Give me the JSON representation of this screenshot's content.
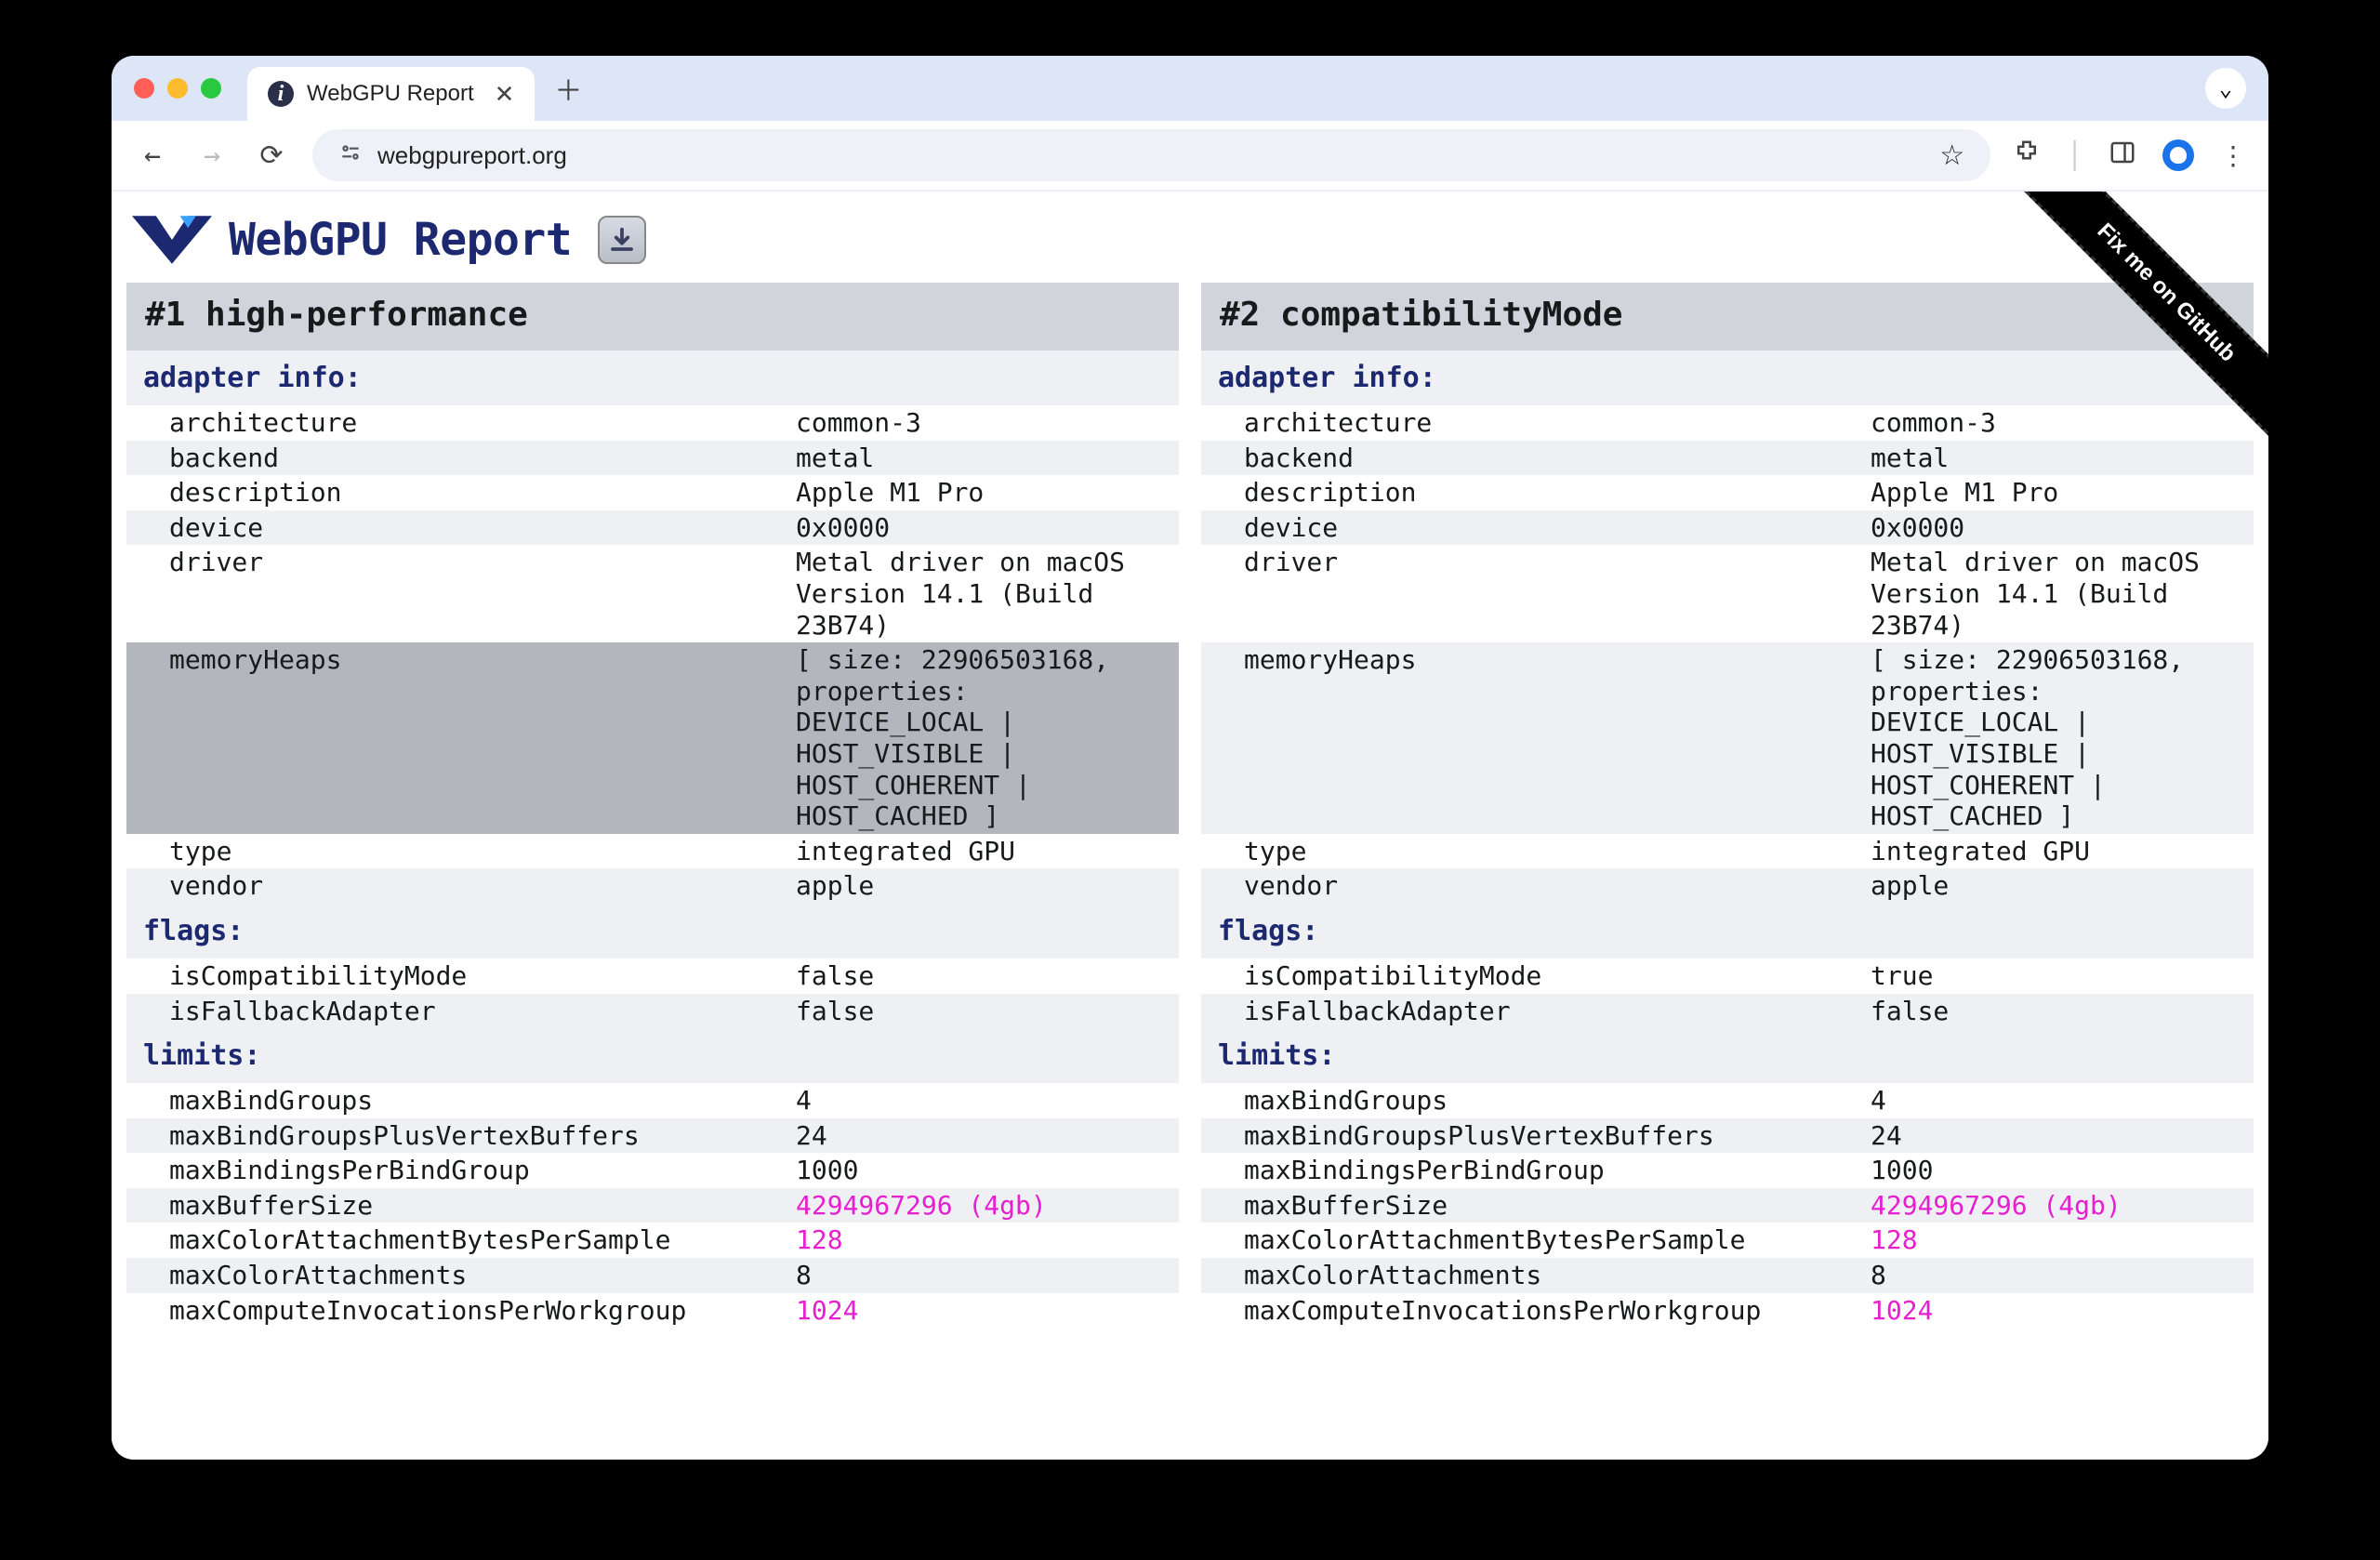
{
  "browser": {
    "tab_title": "WebGPU Report",
    "url_display": "webgpureport.org"
  },
  "hero": {
    "title": "WebGPU Report",
    "download_icon": "download-icon",
    "ribbon_text": "Fix me on GitHub"
  },
  "columns": [
    {
      "heading": "#1 high-performance",
      "sections": [
        {
          "title": "adapter info:",
          "rows": [
            {
              "key": "architecture",
              "value": "common-3",
              "sel": false
            },
            {
              "key": "backend",
              "value": "metal",
              "sel": false
            },
            {
              "key": "description",
              "value": "Apple M1 Pro",
              "sel": false
            },
            {
              "key": "device",
              "value": "0x0000",
              "sel": false
            },
            {
              "key": "driver",
              "value": "Metal driver on macOS Version 14.1 (Build 23B74)",
              "sel": false
            },
            {
              "key": "memoryHeaps",
              "value": "[ size: 22906503168, properties: DEVICE_LOCAL | HOST_VISIBLE | HOST_COHERENT | HOST_CACHED ]",
              "sel": true
            },
            {
              "key": "type",
              "value": "integrated GPU",
              "sel": false
            },
            {
              "key": "vendor",
              "value": "apple",
              "sel": false
            }
          ]
        },
        {
          "title": "flags:",
          "rows": [
            {
              "key": "isCompatibilityMode",
              "value": "false",
              "sel": false
            },
            {
              "key": "isFallbackAdapter",
              "value": "false",
              "sel": false
            }
          ]
        },
        {
          "title": "limits:",
          "rows": [
            {
              "key": "maxBindGroups",
              "value": "4",
              "sel": false
            },
            {
              "key": "maxBindGroupsPlusVertexBuffers",
              "value": "24",
              "sel": false
            },
            {
              "key": "maxBindingsPerBindGroup",
              "value": "1000",
              "sel": false
            },
            {
              "key": "maxBufferSize",
              "value": "4294967296 (4gb)",
              "pink": true,
              "sel": false
            },
            {
              "key": "maxColorAttachmentBytesPerSample",
              "value": "128",
              "pink": true,
              "sel": false
            },
            {
              "key": "maxColorAttachments",
              "value": "8",
              "sel": false
            },
            {
              "key": "maxComputeInvocationsPerWorkgroup",
              "value": "1024",
              "pink": true,
              "sel": false
            }
          ]
        }
      ]
    },
    {
      "heading": "#2 compatibilityMode",
      "sections": [
        {
          "title": "adapter info:",
          "rows": [
            {
              "key": "architecture",
              "value": "common-3",
              "sel": false
            },
            {
              "key": "backend",
              "value": "metal",
              "sel": false
            },
            {
              "key": "description",
              "value": "Apple M1 Pro",
              "sel": false
            },
            {
              "key": "device",
              "value": "0x0000",
              "sel": false
            },
            {
              "key": "driver",
              "value": "Metal driver on macOS Version 14.1 (Build 23B74)",
              "sel": false
            },
            {
              "key": "memoryHeaps",
              "value": "[ size: 22906503168, properties: DEVICE_LOCAL | HOST_VISIBLE | HOST_COHERENT | HOST_CACHED ]",
              "sel": false
            },
            {
              "key": "type",
              "value": "integrated GPU",
              "sel": false
            },
            {
              "key": "vendor",
              "value": "apple",
              "sel": false
            }
          ]
        },
        {
          "title": "flags:",
          "rows": [
            {
              "key": "isCompatibilityMode",
              "value": "true",
              "sel": false
            },
            {
              "key": "isFallbackAdapter",
              "value": "false",
              "sel": false
            }
          ]
        },
        {
          "title": "limits:",
          "rows": [
            {
              "key": "maxBindGroups",
              "value": "4",
              "sel": false
            },
            {
              "key": "maxBindGroupsPlusVertexBuffers",
              "value": "24",
              "sel": false
            },
            {
              "key": "maxBindingsPerBindGroup",
              "value": "1000",
              "sel": false
            },
            {
              "key": "maxBufferSize",
              "value": "4294967296 (4gb)",
              "pink": true,
              "sel": false
            },
            {
              "key": "maxColorAttachmentBytesPerSample",
              "value": "128",
              "pink": true,
              "sel": false
            },
            {
              "key": "maxColorAttachments",
              "value": "8",
              "sel": false
            },
            {
              "key": "maxComputeInvocationsPerWorkgroup",
              "value": "1024",
              "pink": true,
              "sel": false
            }
          ]
        }
      ]
    }
  ]
}
